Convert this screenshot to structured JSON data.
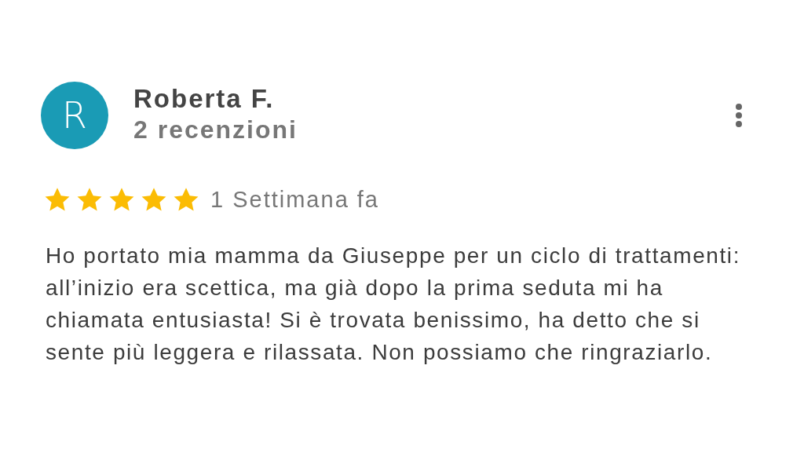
{
  "review": {
    "avatar_letter": "R",
    "author": "Roberta F.",
    "review_count": "2 recenzioni",
    "stars": 5,
    "date": "1 Settimana fa",
    "text": "Ho portato mia mamma da Giuseppe per un ciclo di trattamenti: all’inizio era scettica, ma già dopo la prima seduta mi ha chiamata entusiasta! Si è trovata benissimo, ha detto che si sente più leggera e rilassata. Non possiamo che ringraziarlo."
  }
}
